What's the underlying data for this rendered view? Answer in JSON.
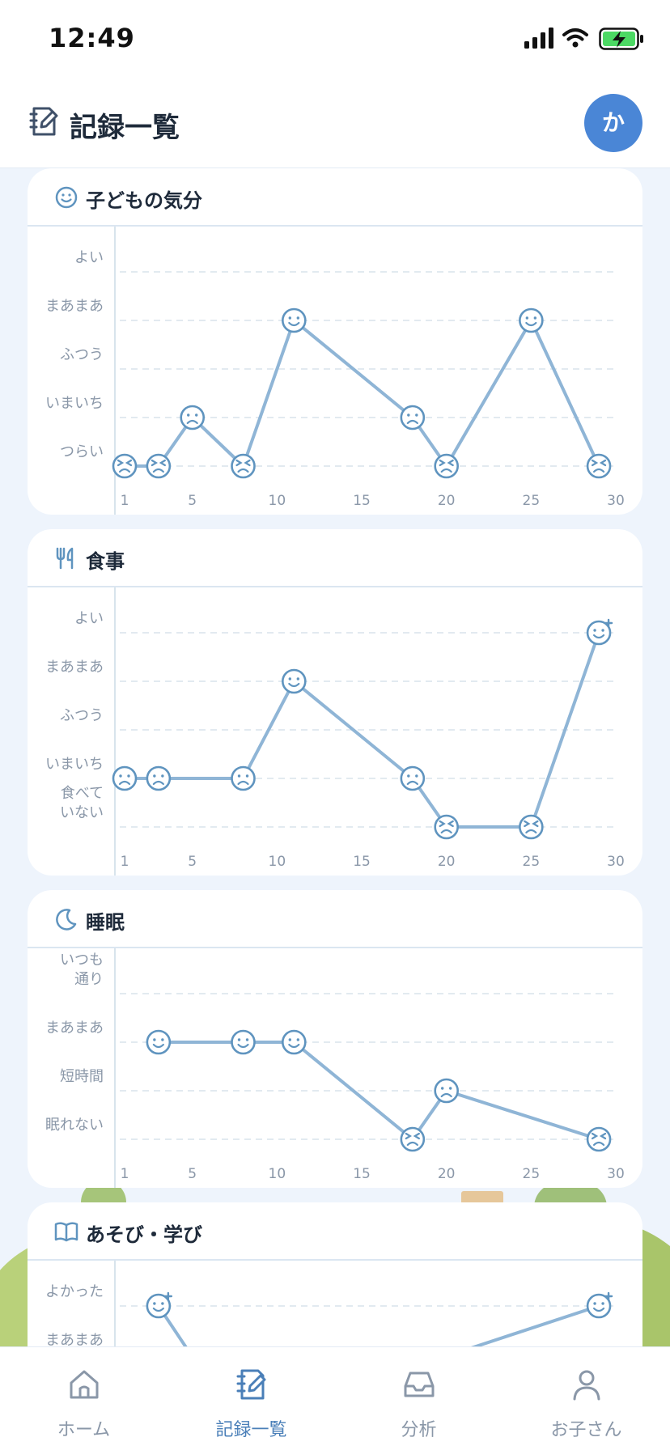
{
  "status_bar": {
    "time": "12:49"
  },
  "header": {
    "title": "記録一覧",
    "avatar_initial": "か"
  },
  "x_ticks": [
    "1",
    "5",
    "10",
    "15",
    "20",
    "25",
    "30"
  ],
  "colors": {
    "accent": "#4a86d6",
    "line": "#8fb5d6",
    "face": "#5f94bf",
    "grid": "#d8e4ec"
  },
  "chart_data": [
    {
      "type": "line",
      "title": "子どもの気分",
      "icon": "smile-icon",
      "y_labels": [
        "よい",
        "まあまあ",
        "ふつう",
        "いまいち",
        "つらい"
      ],
      "xlim": [
        1,
        30
      ],
      "x": [
        1,
        3,
        5,
        8,
        11,
        18,
        20,
        25,
        29
      ],
      "values": [
        "つらい",
        "つらい",
        "いまいち",
        "つらい",
        "まあまあ",
        "いまいち",
        "つらい",
        "まあまあ",
        "つらい"
      ]
    },
    {
      "type": "line",
      "title": "食事",
      "icon": "utensils-icon",
      "y_labels": [
        "よい",
        "まあまあ",
        "ふつう",
        "いまいち",
        "食べて\nいない"
      ],
      "xlim": [
        1,
        30
      ],
      "x": [
        1,
        3,
        8,
        11,
        18,
        20,
        25,
        29
      ],
      "values": [
        "いまいち",
        "いまいち",
        "いまいち",
        "まあまあ",
        "いまいち",
        "食べて\nいない",
        "食べて\nいない",
        "よい"
      ]
    },
    {
      "type": "line",
      "title": "睡眠",
      "icon": "moon-icon",
      "y_labels": [
        "いつも\n通り",
        "まあまあ",
        "短時間",
        "眠れない"
      ],
      "xlim": [
        1,
        30
      ],
      "x": [
        3,
        8,
        11,
        18,
        20,
        29
      ],
      "values": [
        "まあまあ",
        "まあまあ",
        "まあまあ",
        "眠れない",
        "短時間",
        "眠れない"
      ]
    },
    {
      "type": "line",
      "title": "あそび・学び",
      "icon": "book-icon",
      "y_labels": [
        "よかった",
        "まあまあ"
      ],
      "xlim": [
        1,
        30
      ],
      "x": [
        3,
        29
      ],
      "values": [
        "よかった",
        "よかった"
      ]
    }
  ],
  "tab_bar": {
    "tabs": [
      {
        "label": "ホーム",
        "icon": "home-icon",
        "active": false
      },
      {
        "label": "記録一覧",
        "icon": "notebook-icon",
        "active": true
      },
      {
        "label": "分析",
        "icon": "inbox-icon",
        "active": false
      },
      {
        "label": "お子さん",
        "icon": "person-icon",
        "active": false
      }
    ]
  }
}
